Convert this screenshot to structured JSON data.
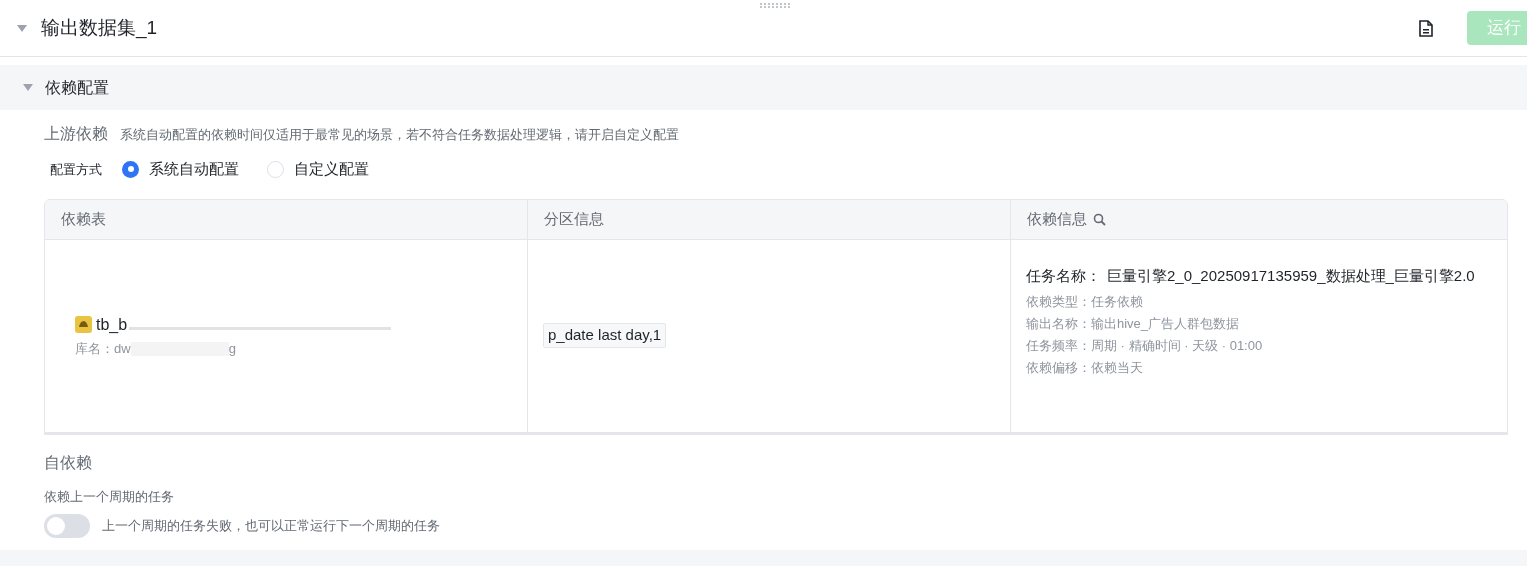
{
  "header": {
    "title": "输出数据集_1",
    "expanded": true,
    "run_button": {
      "label": "运行",
      "disabled": true
    }
  },
  "section": {
    "title": "依赖配置",
    "expanded": true
  },
  "upstream": {
    "title": "上游依赖",
    "hint": "系统自动配置的依赖时间仅适用于最常见的场景，若不符合任务数据处理逻辑，请开启自定义配置",
    "mode_label": "配置方式",
    "modes": [
      {
        "label": "系统自动配置",
        "selected": true
      },
      {
        "label": "自定义配置",
        "selected": false
      }
    ]
  },
  "table": {
    "columns": [
      {
        "label": "依赖表",
        "search": false
      },
      {
        "label": "分区信息",
        "search": false
      },
      {
        "label": "依赖信息",
        "search": true
      }
    ],
    "rows": [
      {
        "table_name": "tb_b",
        "db_label": "库名：",
        "db_prefix": "dw",
        "db_suffix": "g",
        "partition": "p_date last day,1",
        "task_label": "任务名称：",
        "task_name": "巨量引擎2_0_20250917135959_数据处理_巨量引擎2.0",
        "details": [
          "依赖类型：任务依赖",
          "输出名称：输出hive_广告人群包数据",
          "任务频率：周期 · 精确时间 · 天级 · 01:00",
          "依赖偏移：依赖当天"
        ]
      }
    ]
  },
  "self_dependency": {
    "title": "自依赖",
    "label": "依赖上一个周期的任务",
    "toggle": {
      "on": false,
      "text": "上一个周期的任务失败，也可以正常运行下一个周期的任务"
    }
  }
}
